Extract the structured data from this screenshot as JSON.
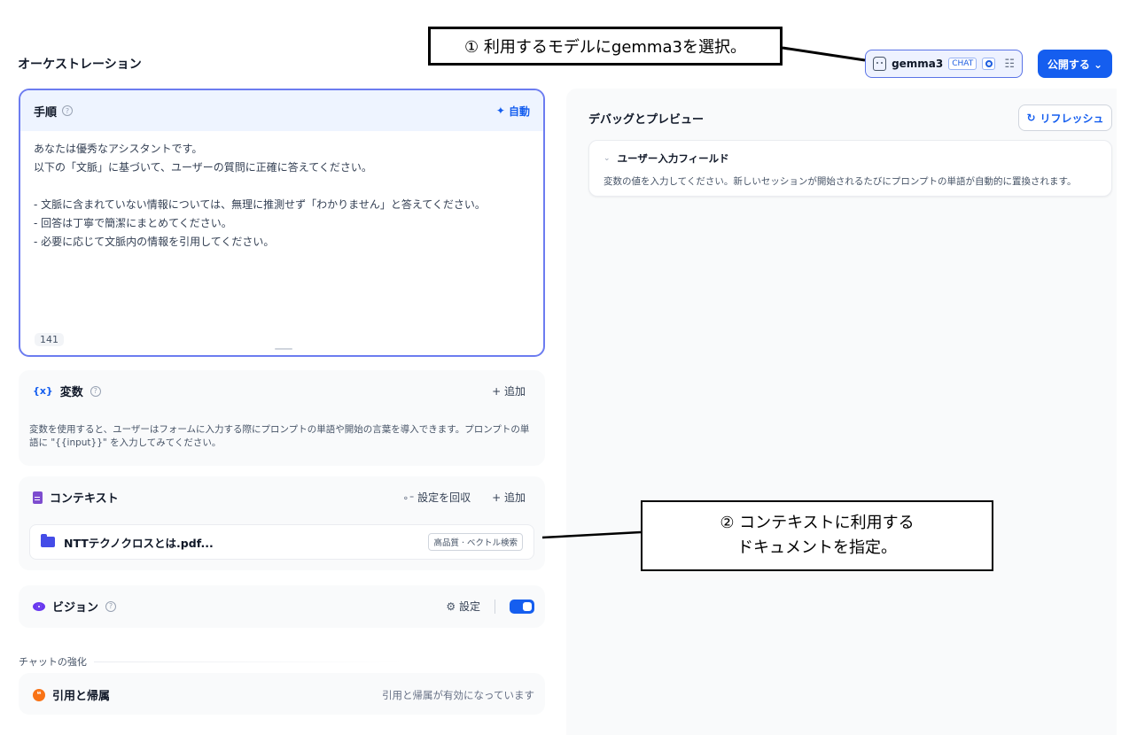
{
  "header": {
    "section_title": "オーケストレーション",
    "model_name": "gemma3",
    "model_tag": "CHAT",
    "publish_label": "公開する ⌄"
  },
  "annotations": {
    "callout1": "① 利用するモデルにgemma3を選択。",
    "callout2_line1": "② コンテキストに利用する",
    "callout2_line2": "ドキュメントを指定。"
  },
  "instructions": {
    "title": "手順",
    "auto_label": "自動",
    "text": "あなたは優秀なアシスタントです。\n以下の「文脈」に基づいて、ユーザーの質問に正確に答えてください。\n\n- 文脈に含まれていない情報については、無理に推測せず「わかりません」と答えてください。\n- 回答は丁寧で簡潔にまとめてください。\n- 必要に応じて文脈内の情報を引用してください。",
    "char_count": "141"
  },
  "variables": {
    "title": "変数",
    "add_label": "+ 追加",
    "description": "変数を使用すると、ユーザーはフォームに入力する際にプロンプトの単語や開始の言葉を導入できます。プロンプトの単語に \"{{input}}\" を入力してみてください。"
  },
  "context": {
    "title": "コンテキスト",
    "retrieval_label": "設定を回収",
    "add_label": "+ 追加",
    "file_name": "NTTテクノクロスとは.pdf...",
    "file_tag": "高品質 · ベクトル検索"
  },
  "vision": {
    "title": "ビジョン",
    "settings_label": "設定",
    "enabled": true
  },
  "chat_enhance": {
    "label": "チャットの強化",
    "citation_title": "引用と帰属",
    "citation_status": "引用と帰属が有効になっています"
  },
  "preview": {
    "title": "デバッグとプレビュー",
    "refresh_label": "リフレッシュ",
    "user_input_title": "ユーザー入力フィールド",
    "user_input_desc": "変数の値を入力してください。新しいセッションが開始されるたびにプロンプトの単語が自動的に置換されます。"
  },
  "colors": {
    "accent": "#155eef",
    "instructions_border": "#6c7cf0",
    "vision_icon": "#6938ef",
    "citation_icon": "#f97316"
  },
  "icons": {
    "model": "robot-mascot-icon",
    "vision_badge": "eye-icon",
    "tune": "sliders-icon",
    "auto": "sparkle-icon",
    "variables": "brackets-x-icon",
    "context": "document-icon",
    "file": "folder-icon",
    "settings": "gear-icon",
    "refresh": "refresh-icon",
    "citation": "quote-icon"
  }
}
